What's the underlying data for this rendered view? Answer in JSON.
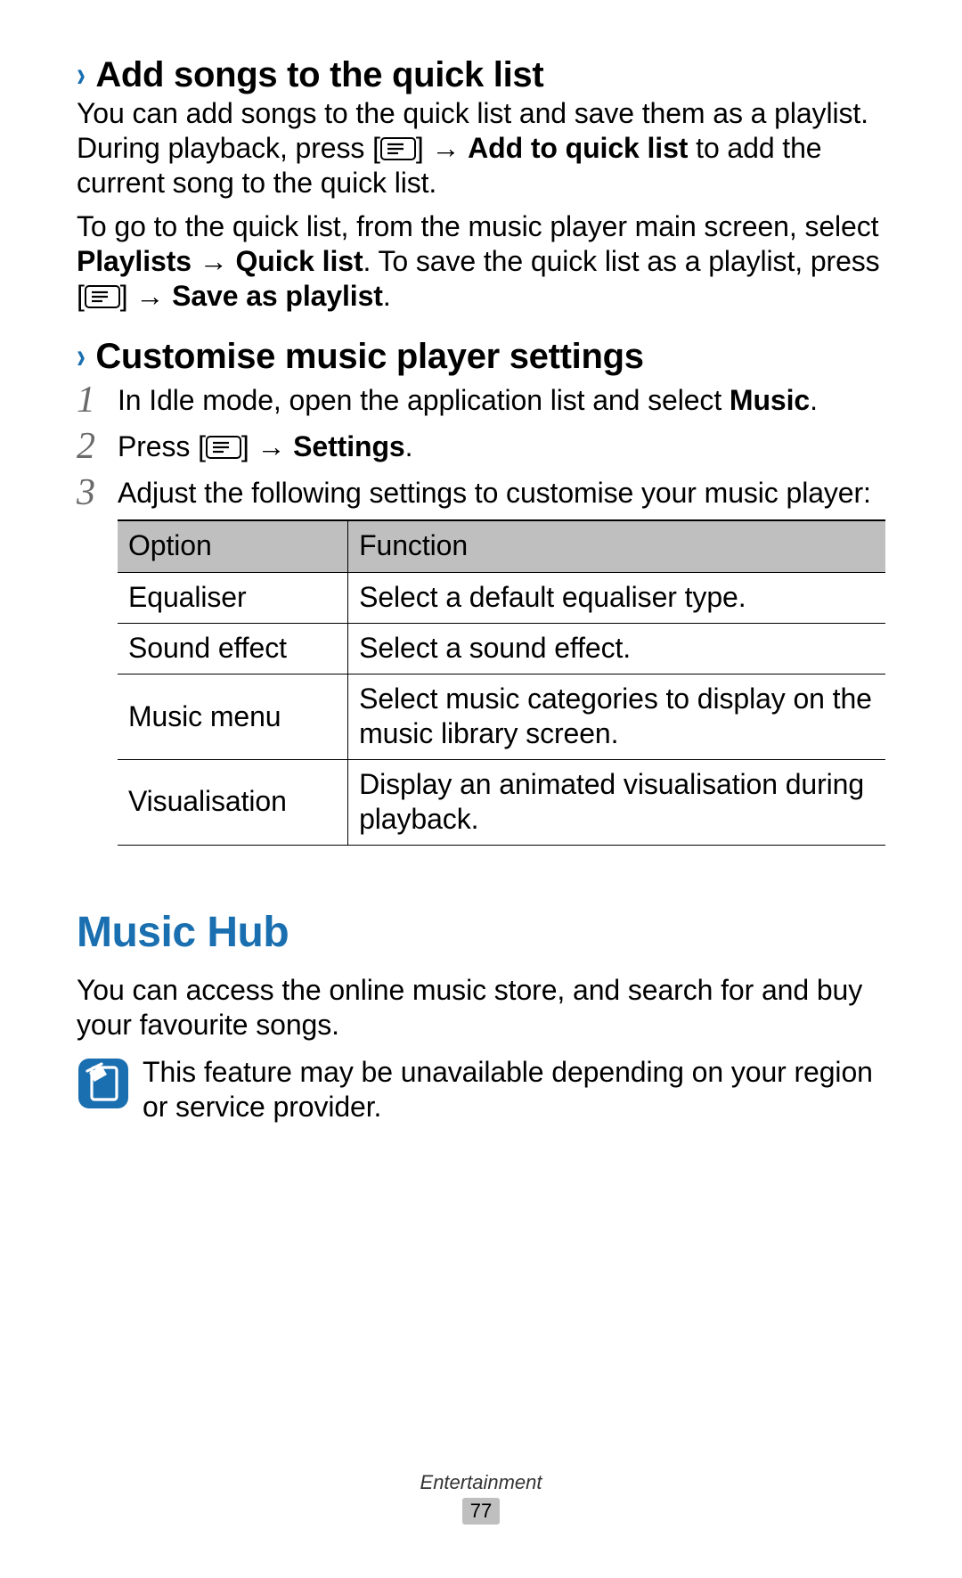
{
  "section1": {
    "chevron": "›",
    "title": "Add songs to the quick list",
    "p1_a": "You can add songs to the quick list and save them as a playlist. During playback, press [",
    "p1_arrow": "] → ",
    "p1_bold": "Add to quick list",
    "p1_b": " to add the current song to the quick list.",
    "p2_a": "To go to the quick list, from the music player main screen, select ",
    "p2_bold1": "Playlists",
    "p2_arrow1": " → ",
    "p2_bold2": "Quick list",
    "p2_b": ". To save the quick list as a playlist, press [",
    "p2_arrow2": "] → ",
    "p2_bold3": "Save as playlist",
    "p2_c": "."
  },
  "section2": {
    "chevron": "›",
    "title": "Customise music player settings",
    "step1_a": "In Idle mode, open the application list and select ",
    "step1_bold": "Music",
    "step1_b": ".",
    "step2_a": "Press [",
    "step2_arrow": "] → ",
    "step2_bold": "Settings",
    "step2_b": ".",
    "step3": "Adjust the following settings to customise your music player:",
    "nums": {
      "n1": "1",
      "n2": "2",
      "n3": "3"
    },
    "table": {
      "head_opt": "Option",
      "head_fn": "Function",
      "rows": [
        {
          "opt": "Equaliser",
          "fn": "Select a default equaliser type."
        },
        {
          "opt": "Sound effect",
          "fn": "Select a sound effect."
        },
        {
          "opt": "Music menu",
          "fn": "Select music categories to display on the music library screen."
        },
        {
          "opt": "Visualisation",
          "fn": "Display an animated visualisation during playback."
        }
      ]
    }
  },
  "musichub": {
    "title": "Music Hub",
    "p1": "You can access the online music store, and search for and buy your favourite songs.",
    "note": "This feature may be unavailable depending on your region or service provider."
  },
  "footer": {
    "category": "Entertainment",
    "page": "77"
  }
}
